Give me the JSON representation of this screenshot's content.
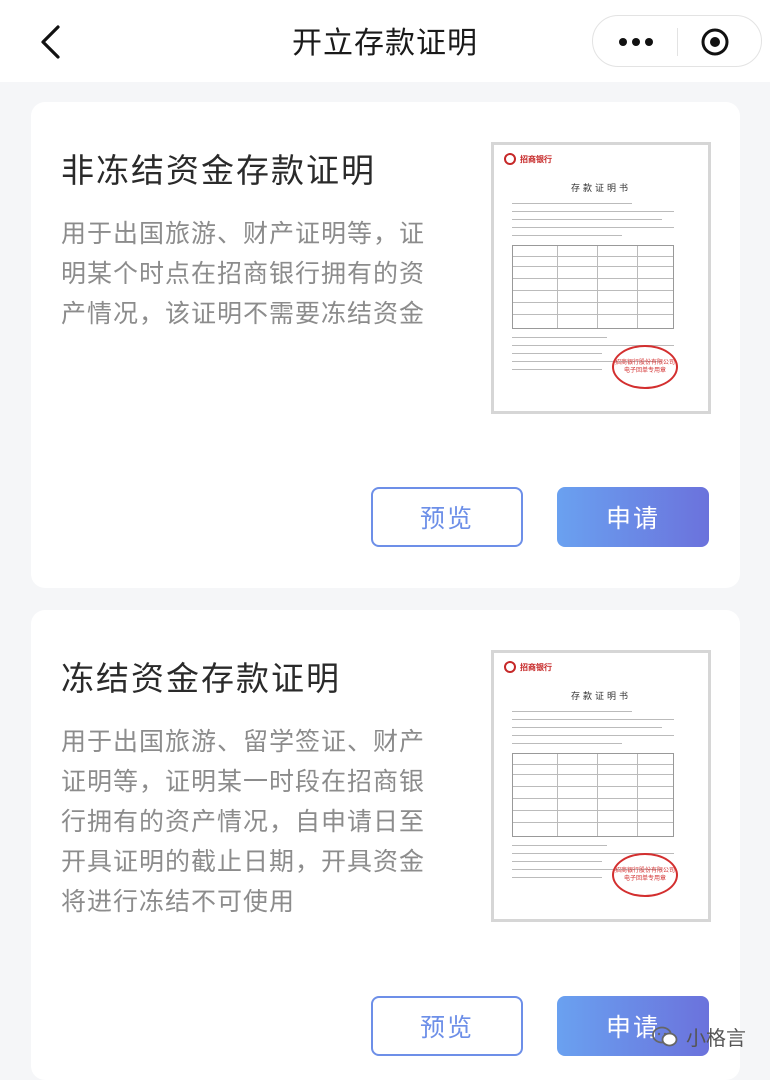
{
  "header": {
    "title": "开立存款证明"
  },
  "cards": [
    {
      "title": "非冻结资金存款证明",
      "description": "用于出国旅游、财产证明等，证明某个时点在招商银行拥有的资产情况，该证明不需要冻结资金",
      "preview_label": "预览",
      "apply_label": "申请",
      "doc": {
        "bank_name": "招商银行",
        "heading": "存款证明书",
        "seal_text": "招商银行股份有限公司 电子回单专用章"
      }
    },
    {
      "title": "冻结资金存款证明",
      "description": "用于出国旅游、留学签证、财产证明等，证明某一时段在招商银行拥有的资产情况，自申请日至开具证明的截止日期，开具资金将进行冻结不可使用",
      "preview_label": "预览",
      "apply_label": "申请",
      "doc": {
        "bank_name": "招商银行",
        "heading": "存款证明书",
        "seal_text": "招商银行股份有限公司 电子回单专用章"
      }
    }
  ],
  "watermark": {
    "text": "小格言"
  },
  "colors": {
    "accent": "#6d8fe8",
    "apply_gradient_start": "#6aa1f0",
    "apply_gradient_end": "#6b72dc",
    "seal_red": "#d32f2f"
  }
}
